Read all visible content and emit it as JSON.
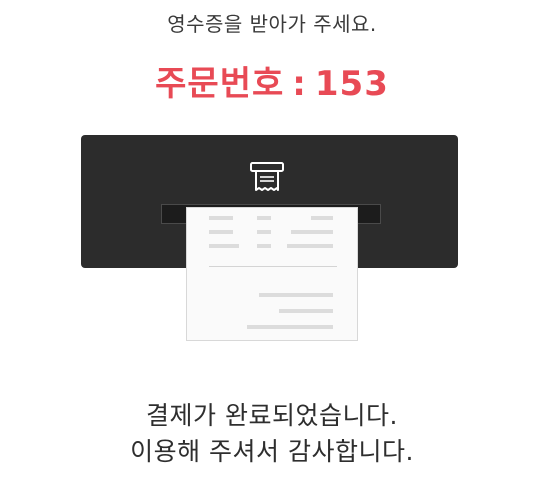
{
  "header": {
    "instruction": "영수증을 받아가 주세요.",
    "order_label": "주문번호",
    "order_separator": ":",
    "order_number": "153"
  },
  "printer": {
    "icon": "receipt-printer-icon",
    "colors": {
      "body": "#2c2c2c",
      "paper": "#fafafa",
      "accent": "#e84a55"
    }
  },
  "footer": {
    "line1": "결제가 완료되었습니다.",
    "line2": "이용해 주셔서 감사합니다."
  }
}
